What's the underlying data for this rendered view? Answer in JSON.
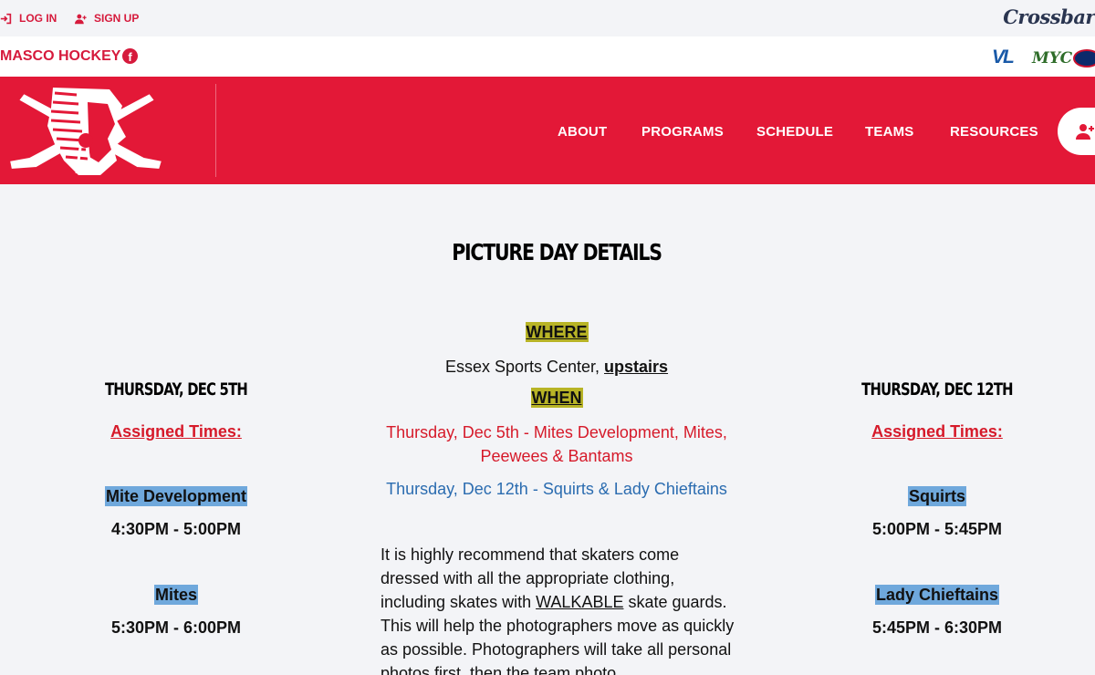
{
  "topbar": {
    "login_label": "LOG IN",
    "signup_label": "SIGN UP",
    "brand": "Crossbar"
  },
  "orgbar": {
    "org_name": "MASCO HOCKEY",
    "facebook_icon": "facebook-icon",
    "partners": [
      "VL",
      "MYC",
      "USA Hockey"
    ]
  },
  "nav": {
    "items": [
      "ABOUT",
      "PROGRAMS",
      "SCHEDULE",
      "TEAMS",
      "RESOURCES"
    ],
    "join_icon": "user-plus-icon"
  },
  "content": {
    "title": "PICTURE DAY DETAILS",
    "where_label": "WHERE",
    "location_text": "Essex Sports Center, ",
    "location_emphasis": "upstairs",
    "when_label": "WHEN",
    "when_line1": "Thursday, Dec 5th - Mites Development, Mites,",
    "when_line2": "Peewees & Bantams",
    "when_line3": "Thursday, Dec 12th - Squirts & Lady Chieftains",
    "para_part1": "It is highly recommend that skaters come dressed with all the appropriate clothing, including skates with ",
    "para_emphasis": "WALKABLE",
    "para_part2": " skate guards. This will help the photographers move as quickly as possible. Photographers will take all personal photos first, then the team photo."
  },
  "left_column": {
    "day": "THURSDAY, DEC 5TH",
    "assigned_label": "Assigned Times:",
    "groups": [
      {
        "name": "Mite Development",
        "time": "4:30PM - 5:00PM"
      },
      {
        "name": "Mites",
        "time": "5:30PM - 6:00PM"
      }
    ]
  },
  "right_column": {
    "day": "THURSDAY, DEC 12TH",
    "assigned_label": "Assigned Times:",
    "groups": [
      {
        "name": "Squirts",
        "time": "5:00PM - 5:45PM"
      },
      {
        "name": "Lady Chieftains",
        "time": "5:45PM - 6:30PM"
      }
    ]
  },
  "colors": {
    "brand_red": "#e31837",
    "text_red": "#d61a2a",
    "highlight_yellow": "#b8b426",
    "highlight_blue": "#6fa8dc",
    "link_blue": "#2b6cb0"
  }
}
